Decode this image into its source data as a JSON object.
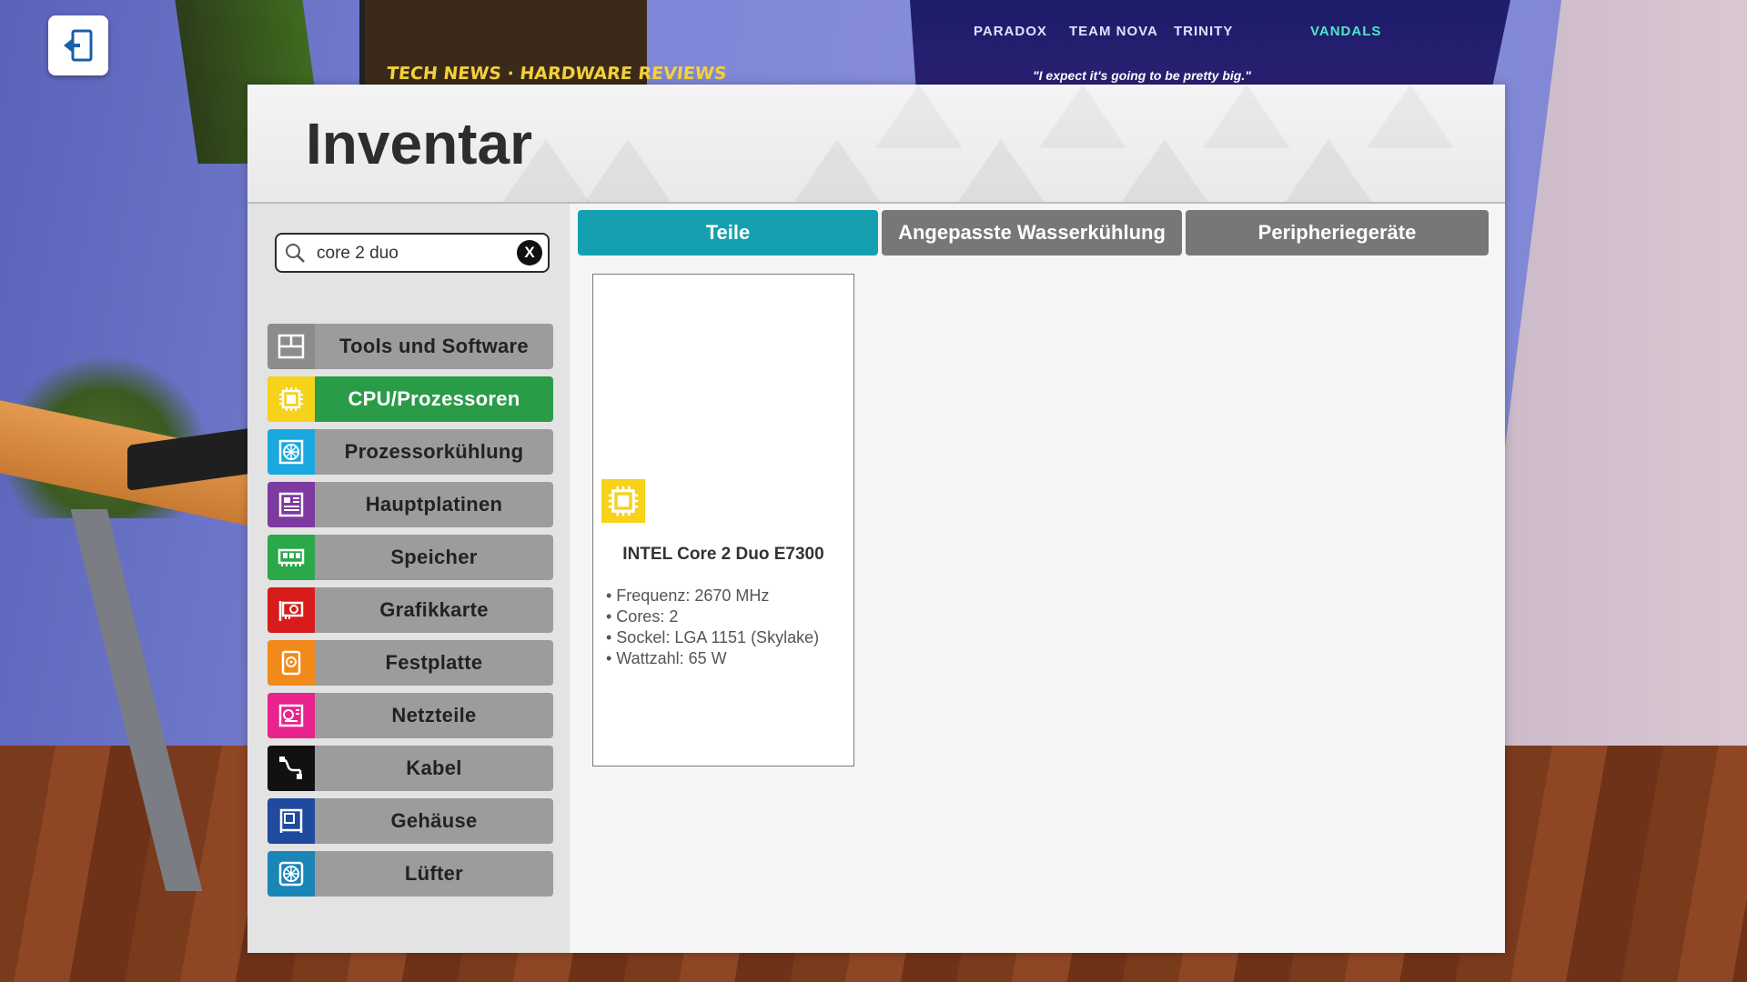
{
  "scene": {
    "poster_left_text": "TECH NEWS · HARDWARE REVIEWS",
    "poster_right_teams": [
      "PARADOX",
      "TEAM NOVA",
      "TRINITY",
      "VANDALS"
    ],
    "poster_right_quote": "\"I expect it's going to be pretty big.\""
  },
  "back_button": {
    "icon": "exit-door-icon"
  },
  "panel": {
    "title": "Inventar"
  },
  "search": {
    "value": "core 2 duo",
    "clear_label": "X"
  },
  "categories": [
    {
      "label": "Tools und Software",
      "icon": "tools-icon",
      "color": "#8c8c8c"
    },
    {
      "label": "CPU/Prozessoren",
      "icon": "cpu-icon",
      "color": "#f6d21a",
      "active": true
    },
    {
      "label": "Prozessorkühlung",
      "icon": "cpu-cooler-icon",
      "color": "#1aa8e0"
    },
    {
      "label": "Hauptplatinen",
      "icon": "motherboard-icon",
      "color": "#7d3aa0"
    },
    {
      "label": "Speicher",
      "icon": "ram-icon",
      "color": "#2aa84a"
    },
    {
      "label": "Grafikkarte",
      "icon": "graphics-card-icon",
      "color": "#d81c1c"
    },
    {
      "label": "Festplatte",
      "icon": "hard-drive-icon",
      "color": "#f28a1a"
    },
    {
      "label": "Netzteile",
      "icon": "power-supply-icon",
      "color": "#e8238c"
    },
    {
      "label": "Kabel",
      "icon": "cable-icon",
      "color": "#111111"
    },
    {
      "label": "Gehäuse",
      "icon": "case-icon",
      "color": "#1f4aa0"
    },
    {
      "label": "Lüfter",
      "icon": "fan-icon",
      "color": "#1a86b8"
    }
  ],
  "tabs": [
    {
      "label": "Teile",
      "active": true
    },
    {
      "label": "Angepasste Wasserkühlung"
    },
    {
      "label": "Peripheriegeräte"
    }
  ],
  "items": [
    {
      "name": "INTEL Core 2 Duo E7300",
      "icon": "cpu-icon",
      "specs": [
        "• Frequenz: 2670 MHz",
        "• Cores: 2",
        "• Sockel: LGA 1151 (Skylake)",
        "• Wattzahl: 65 W"
      ]
    }
  ]
}
